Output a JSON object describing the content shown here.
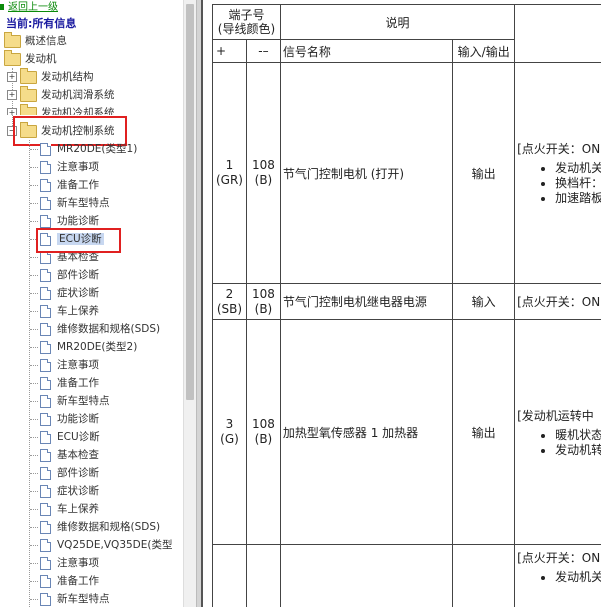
{
  "tree": {
    "back_label": "返回上一级",
    "current_label": "当前:所有信息",
    "top_items": [
      "概述信息",
      "发动机"
    ],
    "engine_children": [
      "发动机结构",
      "发动机润滑系统",
      "发动机冷却系统",
      "发动机控制系统"
    ],
    "docs": [
      "MR20DE(类型1)",
      "注意事项",
      "准备工作",
      "新车型特点",
      "功能诊断",
      "ECU诊断",
      "基本检查",
      "部件诊断",
      "症状诊断",
      "车上保养",
      "维修数据和规格(SDS)",
      "MR20DE(类型2)",
      "注意事项",
      "准备工作",
      "新车型特点",
      "功能诊断",
      "ECU诊断",
      "基本检查",
      "部件诊断",
      "症状诊断",
      "车上保养",
      "维修数据和规格(SDS)",
      "VQ25DE,VQ35DE(类型",
      "注意事项",
      "准备工作",
      "新车型特点"
    ]
  },
  "table": {
    "header_terminal": "端子号\n(导线颜色)",
    "header_desc": "说明",
    "sub_plus": "+",
    "sub_minus": "-–",
    "sub_signal": "信号名称",
    "sub_io": "输入/输出",
    "rows": [
      {
        "plus": "1\n(GR)",
        "minus": "108\n(B)",
        "signal": "节气门控制电机 (打开)",
        "io": "输出",
        "cond": "[点火开关：ON",
        "bullets": [
          "发动机关",
          "换档杆：",
          "加速踏板"
        ]
      },
      {
        "plus": "2\n(SB)",
        "minus": "108\n(B)",
        "signal": "节气门控制电机继电器电源",
        "io": "输入",
        "cond": "[点火开关：ON",
        "bullets": []
      },
      {
        "plus": "3\n(G)",
        "minus": "108\n(B)",
        "signal": "加热型氧传感器 1 加热器",
        "io": "输出",
        "cond": "[发动机运转中",
        "bullets": [
          "暖机状态",
          "发动机转"
        ]
      },
      {
        "plus": "",
        "minus": "",
        "signal": "",
        "io": "",
        "cond": "[点火开关：ON",
        "bullets": [
          "发动机关"
        ]
      }
    ]
  }
}
